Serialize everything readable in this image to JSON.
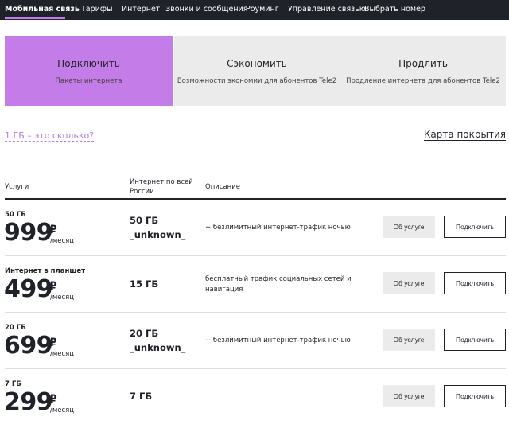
{
  "nav": {
    "items": [
      {
        "label": "Мобильная связь"
      },
      {
        "label": "Тарифы"
      },
      {
        "label": "Интернет"
      },
      {
        "label": "Звонки и сообщения"
      },
      {
        "label": "Роуминг"
      },
      {
        "label": "Управление связью"
      },
      {
        "label": "Выбрать номер"
      }
    ]
  },
  "tabs": [
    {
      "title": "Подключить",
      "subtitle": "Пакеты интернета",
      "active": true
    },
    {
      "title": "Сэкономить",
      "subtitle": "Возможности экономии для абонентов Tele2",
      "active": false
    },
    {
      "title": "Продлить",
      "subtitle": "Продление интернета для абонентов Tele2",
      "active": false
    }
  ],
  "links": {
    "gb_question": "1 ГБ – это сколько?",
    "coverage_map": "Карта покрытия"
  },
  "table": {
    "headers": {
      "services": "Услуги",
      "internet": "Интернет по всей России",
      "description": "Описание"
    },
    "rows": [
      {
        "name": "50 ГБ",
        "price": "999",
        "currency": "₽",
        "period": "/месяц",
        "volume": "50 ГБ",
        "volume_note": "_unknown_",
        "description": "+ безлимитный интернет-трафик ночью",
        "info_label": "Об услуге",
        "connect_label": "Подключить"
      },
      {
        "name": "Интернет в планшет",
        "price": "499",
        "currency": "₽",
        "period": "/месяц",
        "volume": "15 ГБ",
        "volume_note": "",
        "description": "бесплатный трафик социальных сетей и навигация",
        "info_label": "Об услуге",
        "connect_label": "Подключить"
      },
      {
        "name": "20 ГБ",
        "price": "699",
        "currency": "₽",
        "period": "/месяц",
        "volume": "20 ГБ",
        "volume_note": "_unknown_",
        "description": "+ безлимитный интернет-трафик ночью",
        "info_label": "Об услуге",
        "connect_label": "Подключить"
      },
      {
        "name": "7 ГБ",
        "price": "299",
        "currency": "₽",
        "period": "/месяц",
        "volume": "7 ГБ",
        "volume_note": "",
        "description": "",
        "info_label": "Об услуге",
        "connect_label": "Подключить"
      }
    ]
  },
  "colors": {
    "accent": "#c47de8",
    "dark": "#1f2229",
    "tab_inactive": "#ebebeb",
    "link": "#b67cdf"
  }
}
